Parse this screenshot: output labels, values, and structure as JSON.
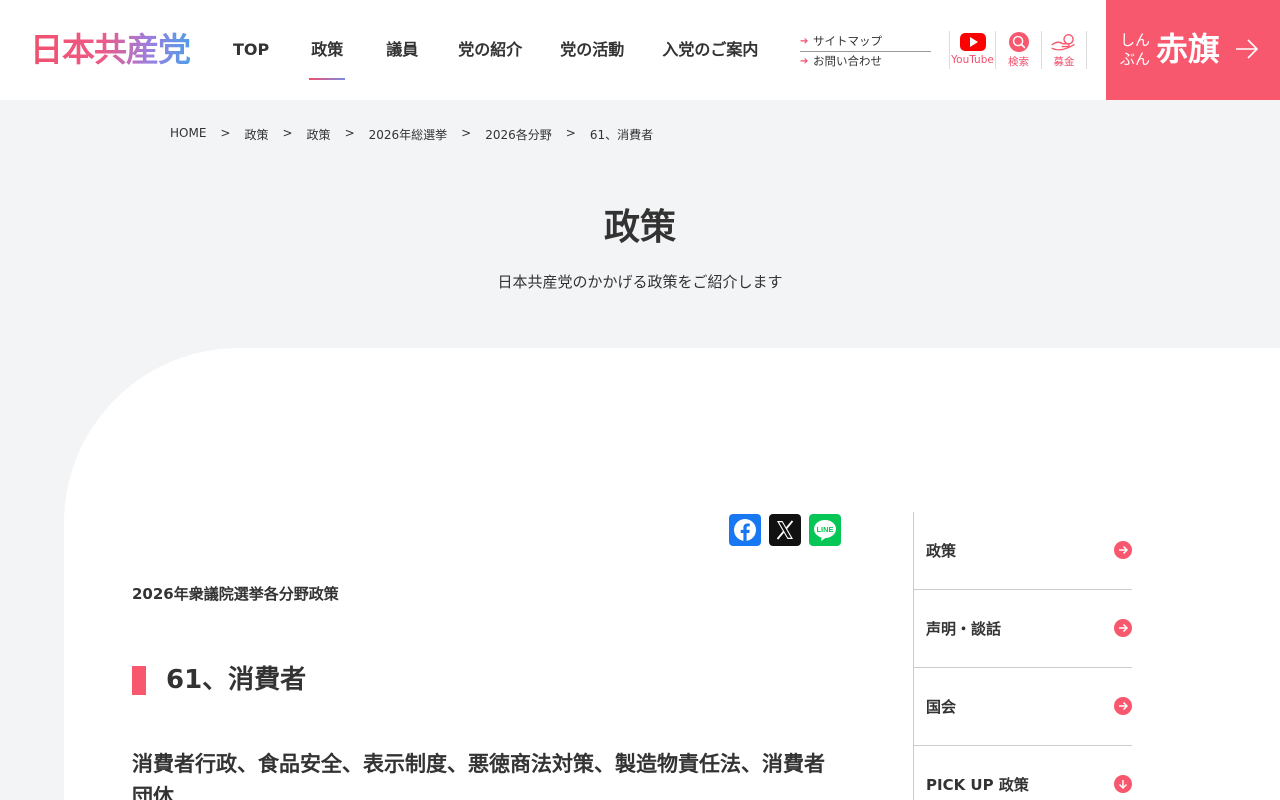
{
  "header": {
    "logo": "日本共産党",
    "nav": [
      {
        "label": "TOP"
      },
      {
        "label": "政策",
        "active": true
      },
      {
        "label": "議員"
      },
      {
        "label": "党の紹介"
      },
      {
        "label": "党の活動"
      },
      {
        "label": "入党のご案内"
      }
    ],
    "subnav": {
      "sitemap": "サイトマップ",
      "contact": "お問い合わせ"
    },
    "icons": {
      "youtube": "YouTube",
      "search": "検索",
      "donation": "募金"
    },
    "akahata": {
      "small_line1": "しん",
      "small_line2": "ぶん",
      "big": "赤旗"
    }
  },
  "breadcrumb": [
    "HOME",
    "政策",
    "政策",
    "2026年総選挙",
    "2026各分野",
    "61、消費者"
  ],
  "breadcrumb_separator": ">",
  "page": {
    "title": "政策",
    "lead": "日本共産党のかかげる政策をご紹介します"
  },
  "article": {
    "category": "2026年衆議院選挙各分野政策",
    "title": "61、消費者",
    "subtitle": "消費者行政、食品安全、表示制度、悪徳商法対策、製造物責任法、消費者団体"
  },
  "sidenav": [
    "政策",
    "声明・談話",
    "国会",
    "PICK UP 政策"
  ],
  "colors": {
    "accent": "#f8586e",
    "background": "#f3f4f6"
  }
}
